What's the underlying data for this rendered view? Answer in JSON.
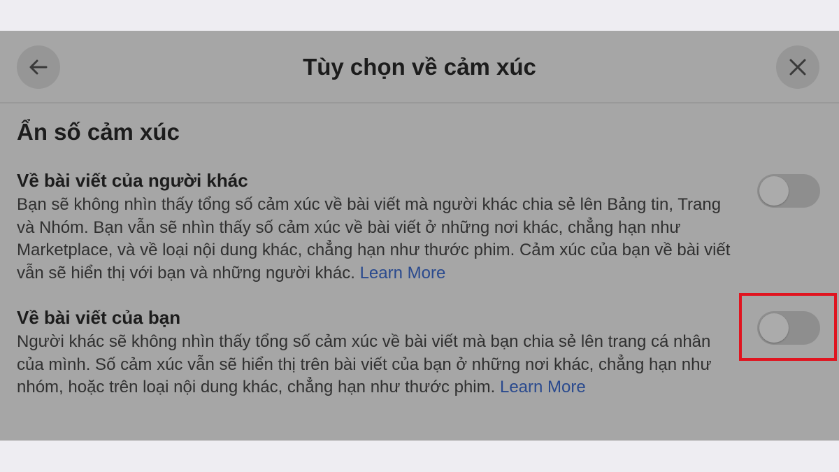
{
  "dialog": {
    "title": "Tùy chọn về cảm xúc",
    "back_icon": "arrow-left-icon",
    "close_icon": "close-icon"
  },
  "section": {
    "title": "Ẩn số cảm xúc"
  },
  "settings": [
    {
      "label": "Về bài viết của người khác",
      "description": "Bạn sẽ không nhìn thấy tổng số cảm xúc về bài viết mà người khác chia sẻ lên Bảng tin, Trang và Nhóm. Bạn vẫn sẽ nhìn thấy số cảm xúc về bài viết ở những nơi khác, chẳng hạn như Marketplace, và về loại nội dung khác, chẳng hạn như thước phim. Cảm xúc của bạn về bài viết vẫn sẽ hiển thị với bạn và những người khác.",
      "link": "Learn More",
      "enabled": false
    },
    {
      "label": "Về bài viết của bạn",
      "description": "Người khác sẽ không nhìn thấy tổng số cảm xúc về bài viết mà bạn chia sẻ lên trang cá nhân của mình. Số cảm xúc vẫn sẽ hiển thị trên bài viết của bạn ở những nơi khác, chẳng hạn như nhóm, hoặc trên loại nội dung khác, chẳng hạn như thước phim.",
      "link": "Learn More",
      "enabled": false,
      "highlighted": true
    }
  ],
  "colors": {
    "highlight": "#e0141f",
    "link": "#2a4a8e",
    "overlay": "#a6a6a6"
  }
}
